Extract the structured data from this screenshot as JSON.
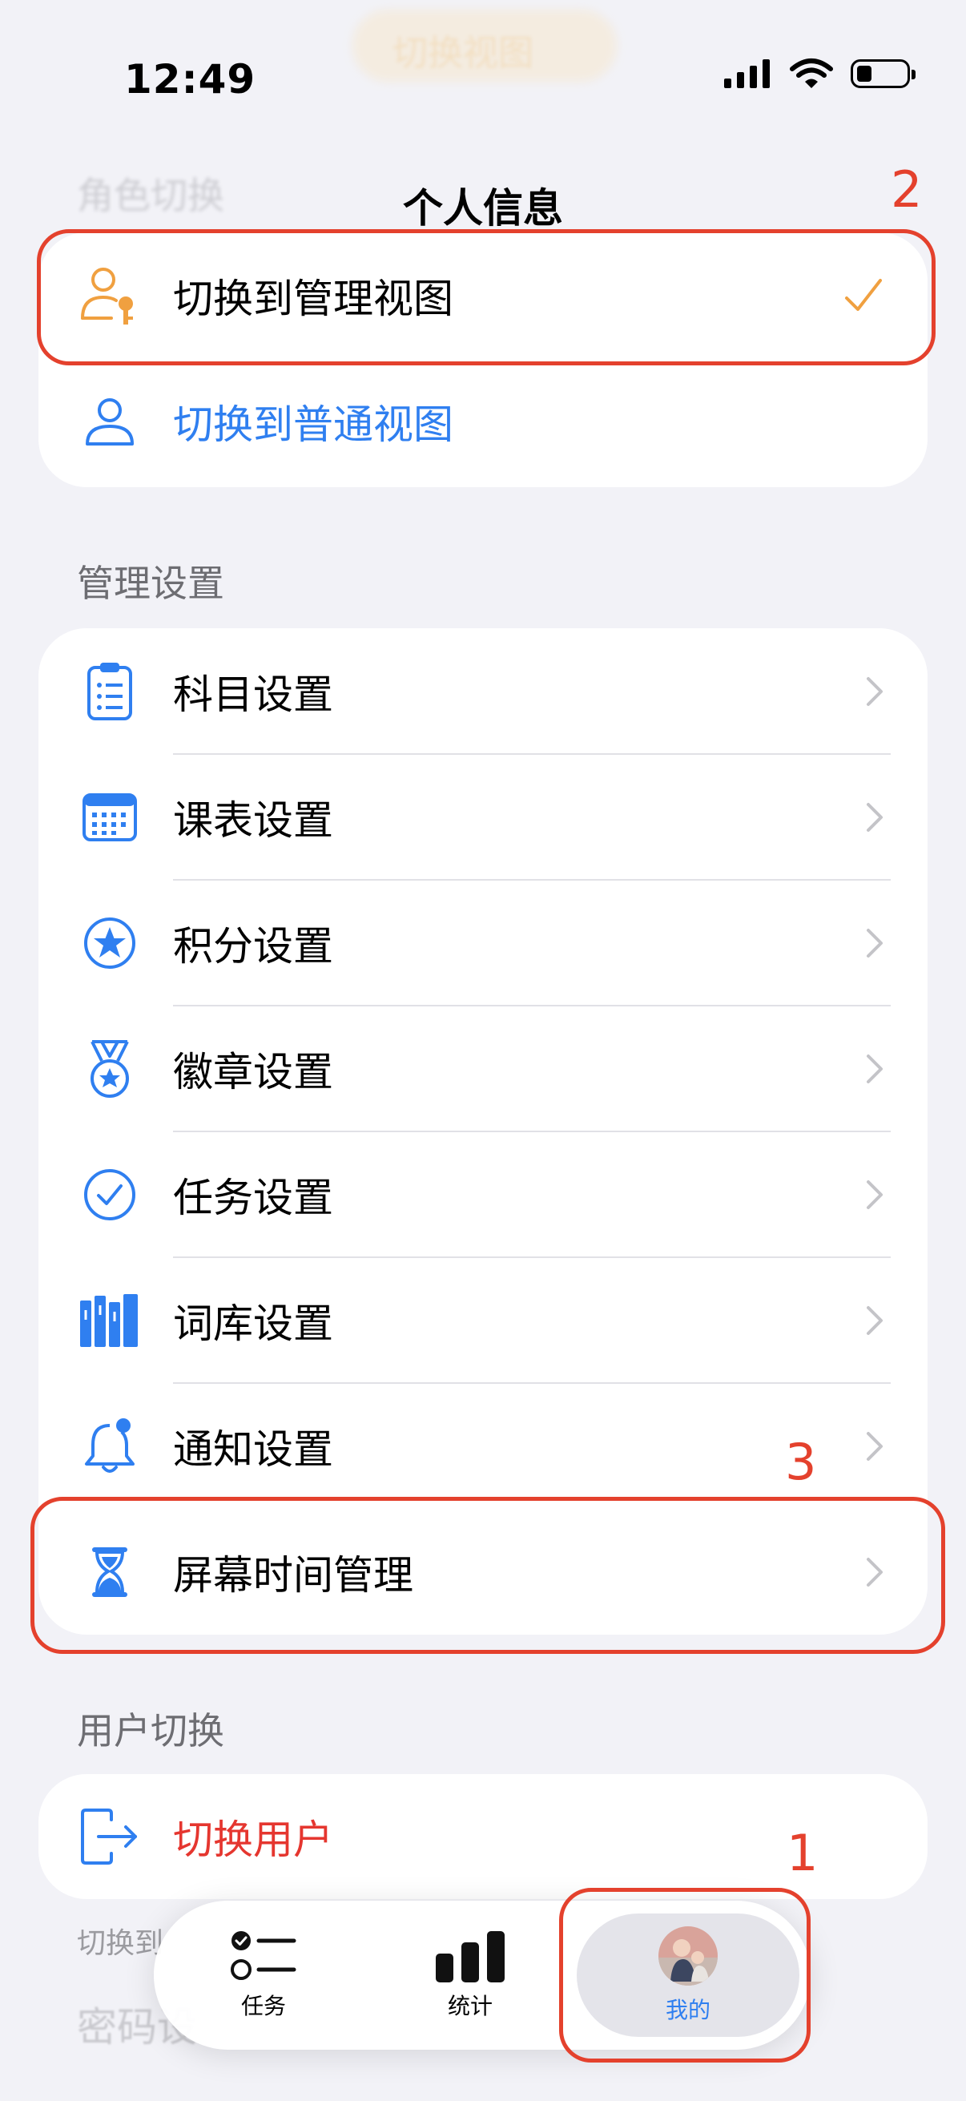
{
  "status_bar": {
    "time": "12:49"
  },
  "top_ghost": {
    "text": "切换视图"
  },
  "ghost_header": "角色切换",
  "nav_title": "个人信息",
  "view_switch": {
    "items": [
      {
        "label": "切换到管理视图",
        "icon": "person-key-icon",
        "selected": true
      },
      {
        "label": "切换到普通视图",
        "icon": "person-icon",
        "selected": false
      }
    ]
  },
  "management": {
    "header": "管理设置",
    "items": [
      {
        "label": "科目设置",
        "icon": "clipboard-list-icon"
      },
      {
        "label": "课表设置",
        "icon": "calendar-icon"
      },
      {
        "label": "积分设置",
        "icon": "star-circle-icon"
      },
      {
        "label": "徽章设置",
        "icon": "medal-icon"
      },
      {
        "label": "任务设置",
        "icon": "checkmark-circle-icon"
      },
      {
        "label": "词库设置",
        "icon": "books-icon"
      },
      {
        "label": "通知设置",
        "icon": "bell-icon"
      },
      {
        "label": "屏幕时间管理",
        "icon": "hourglass-icon"
      }
    ]
  },
  "user_switch": {
    "header": "用户切换",
    "item": {
      "label": "切换用户",
      "icon": "exit-arrow-icon"
    },
    "footer_text": "切换到"
  },
  "password_section": {
    "header": "密码设"
  },
  "annotations": {
    "one": "1",
    "two": "2",
    "three": "3"
  },
  "tabbar": {
    "tabs": [
      {
        "label": "任务",
        "icon": "task-list-icon",
        "selected": false
      },
      {
        "label": "统计",
        "icon": "bar-chart-icon",
        "selected": false
      },
      {
        "label": "我的",
        "icon": "avatar",
        "selected": true
      }
    ]
  },
  "colors": {
    "accent_blue": "#2f7ff0",
    "accent_orange": "#f0a040",
    "danger_red": "#e5362f",
    "annotation_red": "#e4412d"
  }
}
